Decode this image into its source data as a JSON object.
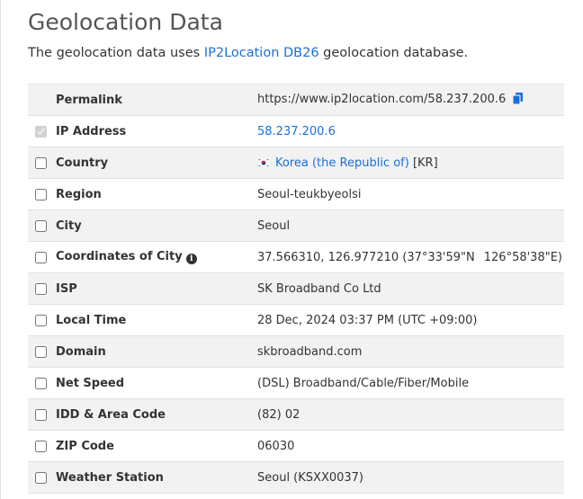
{
  "header": {
    "title": "Geolocation Data",
    "subtitle_pre": "The geolocation data uses ",
    "subtitle_link": "IP2Location DB26",
    "subtitle_post": " geolocation database."
  },
  "rows": [
    {
      "label": "Permalink",
      "value": "https://www.ip2location.com/58.237.200.6",
      "checkbox": false
    },
    {
      "label": "IP Address",
      "value": "58.237.200.6",
      "checkbox": true,
      "checked": true,
      "disabled": true
    },
    {
      "label": "Country",
      "value": "Korea (the Republic of)",
      "suffix": " [KR]",
      "checkbox": true
    },
    {
      "label": "Region",
      "value": "Seoul-teukbyeolsi",
      "checkbox": true
    },
    {
      "label": "City",
      "value": "Seoul",
      "checkbox": true
    },
    {
      "label": "Coordinates of City",
      "value": "37.566310, 126.977210 (37°33'59\"N",
      "value2": "126°58'38\"E)",
      "checkbox": true
    },
    {
      "label": "ISP",
      "value": "SK Broadband Co Ltd",
      "checkbox": true
    },
    {
      "label": "Local Time",
      "value": "28 Dec, 2024 03:37 PM (UTC +09:00)",
      "checkbox": true
    },
    {
      "label": "Domain",
      "value": "skbroadband.com",
      "checkbox": true
    },
    {
      "label": "Net Speed",
      "value": "(DSL) Broadband/Cable/Fiber/Mobile",
      "checkbox": true
    },
    {
      "label": "IDD & Area Code",
      "value": "(82) 02",
      "checkbox": true
    },
    {
      "label": "ZIP Code",
      "value": "06030",
      "checkbox": true
    },
    {
      "label": "Weather Station",
      "value": "Seoul (KSXX0037)",
      "checkbox": true
    }
  ],
  "icons": {
    "copy": "copy-icon",
    "info": "info-icon",
    "flag": "south-korea-flag-icon"
  },
  "colors": {
    "link": "#1a6fd6",
    "row_stripe": "#f2f2f2"
  }
}
